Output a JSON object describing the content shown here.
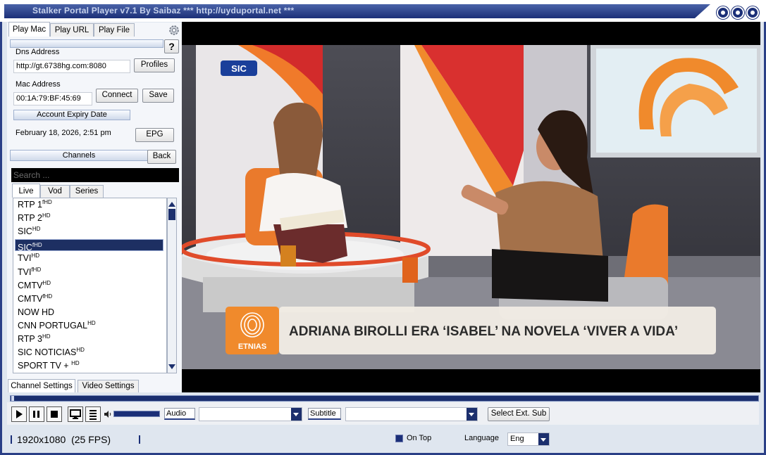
{
  "window": {
    "title": "Stalker Portal Player v7.1 By Saibaz   *** http://uyduportal.net ***"
  },
  "tabs": {
    "play_mac": "Play Mac",
    "play_url": "Play URL",
    "play_file": "Play File",
    "help": "?"
  },
  "connection": {
    "dns_label": "Dns Address",
    "dns_value": "http://gt.6738hg.com:8080",
    "profiles_button": "Profiles",
    "mac_label": "Mac Address",
    "mac_value": "00:1A:79:BF:45:69",
    "connect_button": "Connect",
    "save_button": "Save",
    "expiry_label": "Account Expiry Date",
    "expiry_value": "February 18, 2026, 2:51 pm",
    "epg_button": "EPG"
  },
  "channels": {
    "header": "Channels",
    "back_button": "Back",
    "search_placeholder": "Search ...",
    "tabs": [
      "Live",
      "Vod",
      "Series"
    ],
    "items": [
      {
        "name": "RTP 1",
        "sup": "fHD"
      },
      {
        "name": "RTP 2",
        "sup": "HD"
      },
      {
        "name": "SIC",
        "sup": "HD"
      },
      {
        "name": "SIC",
        "sup": "fHD",
        "selected": true
      },
      {
        "name": "TVI",
        "sup": "HD"
      },
      {
        "name": "TVI",
        "sup": "fHD"
      },
      {
        "name": "CMTV",
        "sup": "HD"
      },
      {
        "name": "CMTV",
        "sup": "fHD"
      },
      {
        "name": "NOW HD",
        "sup": ""
      },
      {
        "name": "CNN PORTUGAL",
        "sup": "HD"
      },
      {
        "name": "RTP 3",
        "sup": "HD"
      },
      {
        "name": "SIC NOTICIAS",
        "sup": "HD"
      },
      {
        "name": "SPORT TV + ",
        "sup": "HD"
      }
    ]
  },
  "settings_tabs": {
    "channel": "Channel Settings",
    "video": "Video Settings"
  },
  "video": {
    "channel_logo": "SIC",
    "lower_third_brand": "ETNIAS",
    "headline": "ADRIANA BIROLLI ERA ‘ISABEL’ NA NOVELA ‘VIVER A VIDA’"
  },
  "controls": {
    "audio_label": "Audio",
    "subtitle_label": "Subtitle",
    "select_ext_sub": "Select Ext. Sub",
    "volume_level": 1.0
  },
  "status": {
    "resolution": "1920x1080  (25 FPS)",
    "on_top_label": "On Top",
    "language_label": "Language",
    "language_value": "Eng"
  },
  "colors": {
    "accent": "#1b2f78",
    "selection": "#1d2f62",
    "lower_third_orange": "#f08a2c"
  }
}
